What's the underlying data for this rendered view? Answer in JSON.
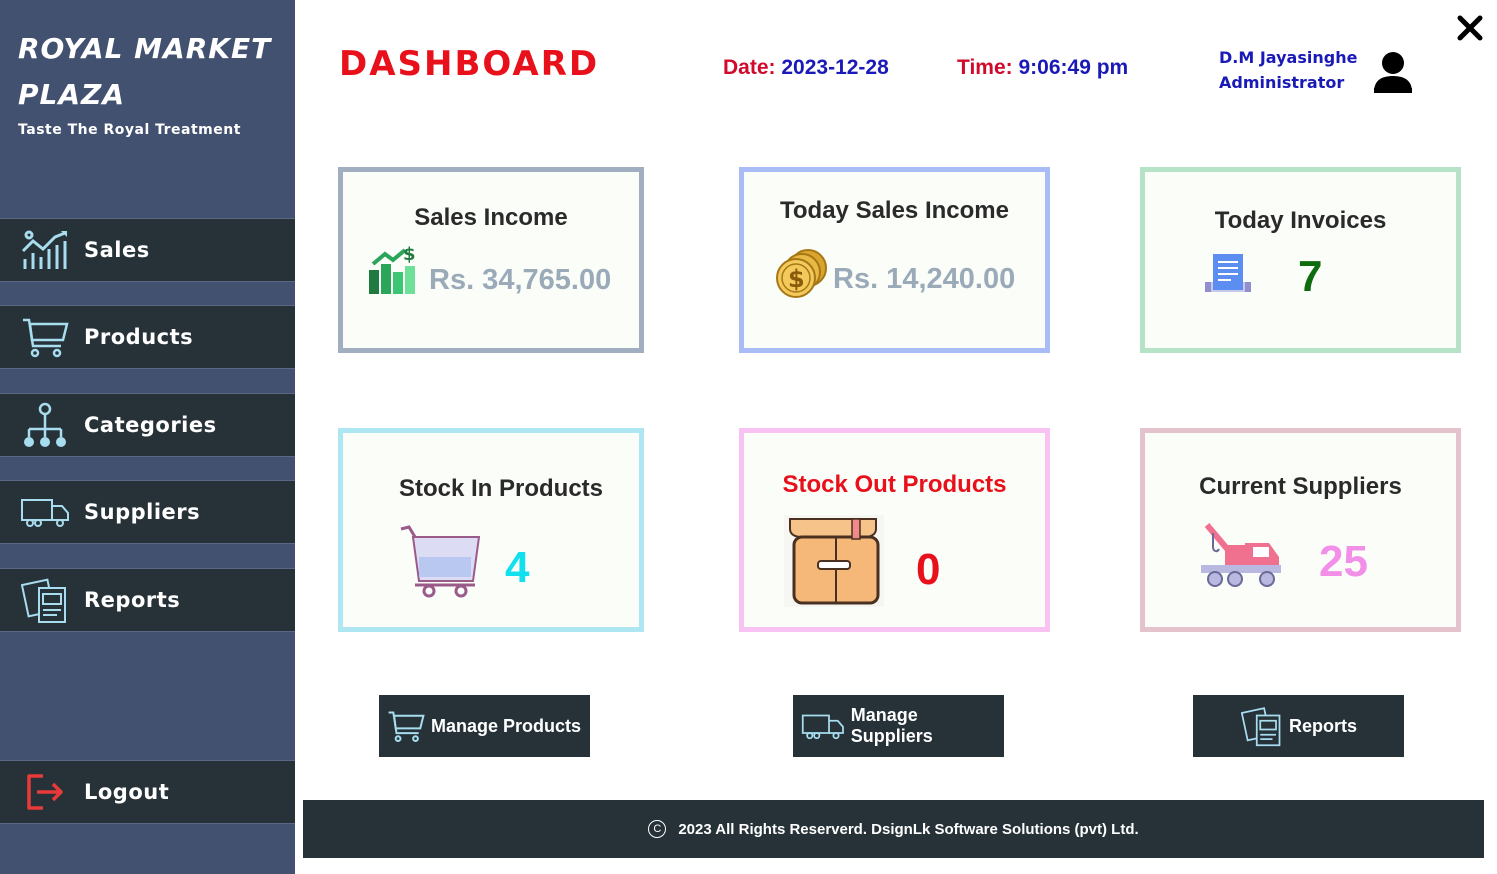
{
  "sidebar": {
    "brand_title": "ROYAL MARKET PLAZA",
    "tagline": "Taste The Royal Treatment",
    "items": [
      {
        "label": "Sales",
        "icon": "sales-chart-icon"
      },
      {
        "label": "Products",
        "icon": "cart-icon"
      },
      {
        "label": "Categories",
        "icon": "hierarchy-icon"
      },
      {
        "label": "Suppliers",
        "icon": "truck-icon"
      },
      {
        "label": "Reports",
        "icon": "report-icon"
      }
    ],
    "logout_label": "Logout"
  },
  "header": {
    "title": "DASHBOARD",
    "date_label": "Date:",
    "date_value": "2023-12-28",
    "time_label": "Time:",
    "time_value": "9:06:49 pm",
    "user_name": "D.M Jayasinghe",
    "user_role": "Administrator"
  },
  "cards": {
    "sales_income": {
      "title": "Sales Income",
      "value": "Rs. 34,765.00",
      "border": "#a0aec0",
      "value_color": "#9aaab8"
    },
    "today_sales_income": {
      "title": "Today Sales Income",
      "value": "Rs. 14,240.00",
      "border": "#a9bcf5",
      "value_color": "#9aaab8"
    },
    "today_invoices": {
      "title": "Today Invoices",
      "value": "7",
      "border": "#b6e3c7",
      "value_color": "#0f6b0f"
    },
    "stock_in": {
      "title": "Stock In Products",
      "value": "4",
      "border": "#aee6f2",
      "value_color": "#12e0ee"
    },
    "stock_out": {
      "title": "Stock Out Products",
      "value": "0",
      "border": "#f8c3f2",
      "value_color": "#e8101a",
      "title_color": "#e8101a"
    },
    "current_suppliers": {
      "title": "Current Suppliers",
      "value": "25",
      "border": "#e4c3cc",
      "value_color": "#f28fe8"
    }
  },
  "quick_actions": {
    "manage_products": "Manage Products",
    "manage_suppliers": "Manage Suppliers",
    "reports": "Reports"
  },
  "footer": {
    "copyright_symbol": "C",
    "text": "2023 All Rights Reserverd. DsignLk Software Solutions (pvt) Ltd."
  }
}
